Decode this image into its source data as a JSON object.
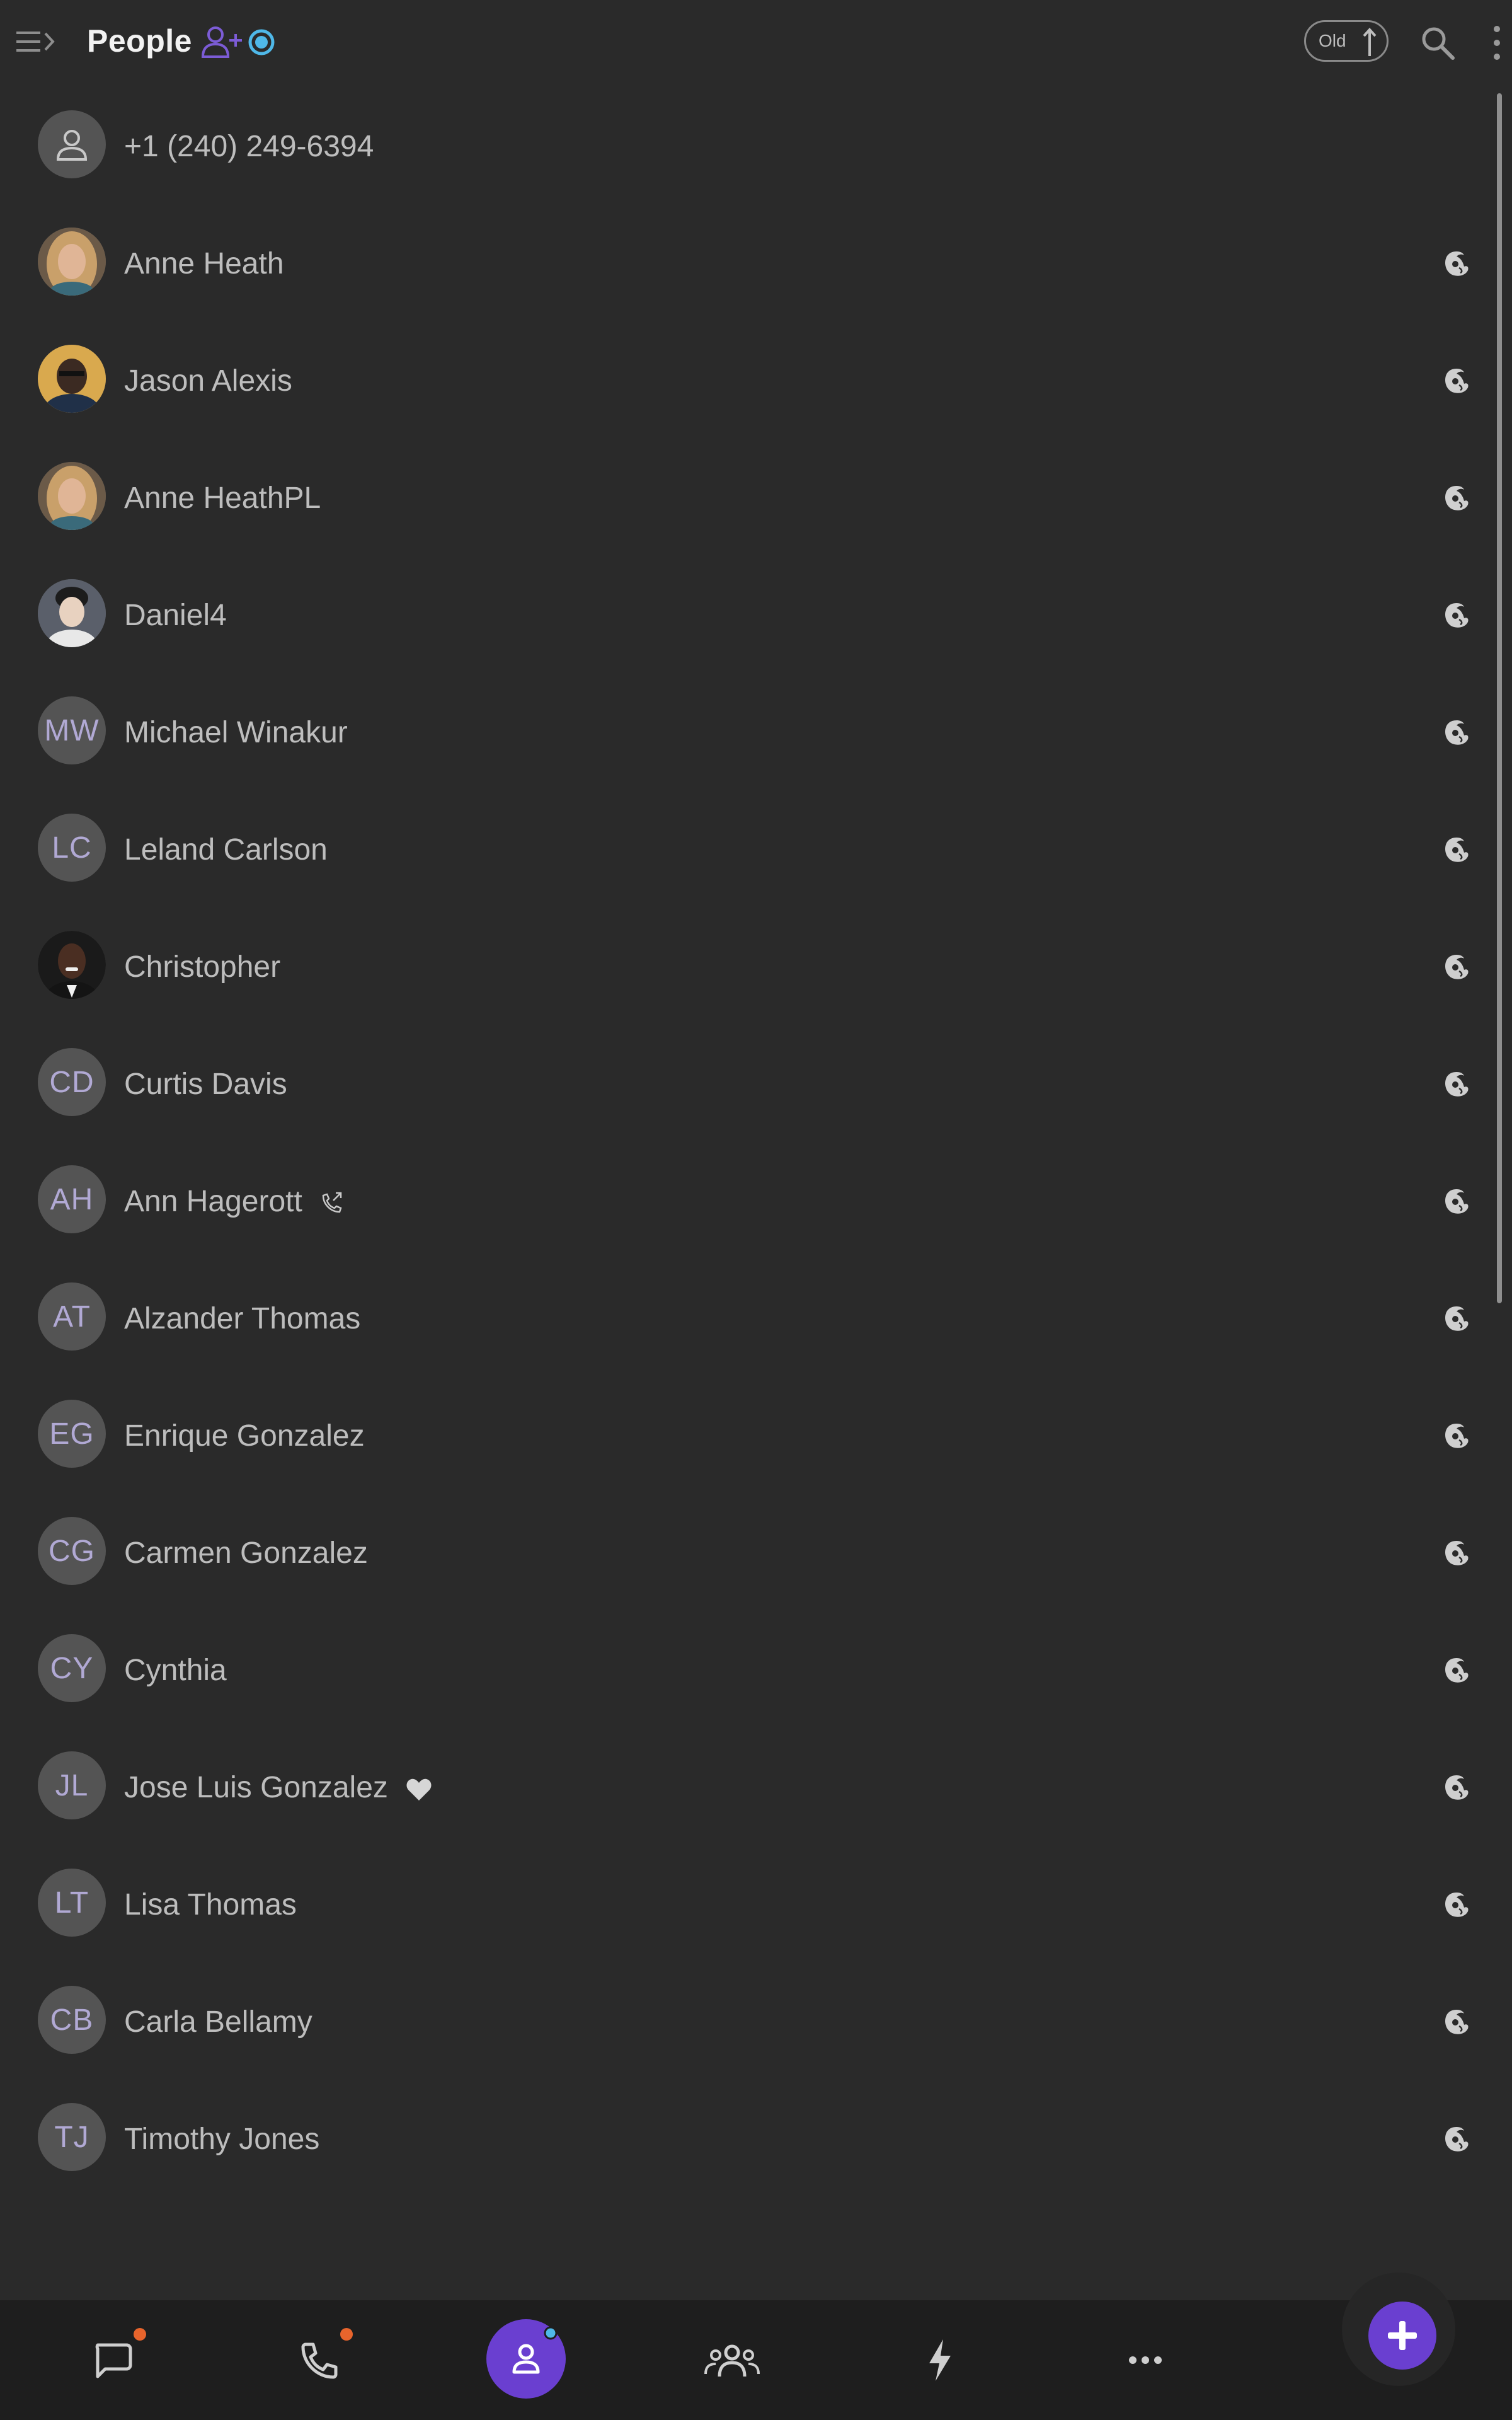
{
  "header": {
    "title": "People",
    "sort_label": "Old"
  },
  "colors": {
    "background": "#2a2a2a",
    "bottom_nav": "#1e1e1e",
    "accent": "#6a3fd0",
    "status_blue": "#4fb8e8",
    "badge_orange": "#e8642c",
    "avatar_gray": "#545454",
    "initials_lavender": "#b1a9d4"
  },
  "contacts": [
    {
      "name": "+1 (240) 249-6394",
      "avatar": "generic-person-icon"
    },
    {
      "name": "Anne Heath",
      "avatar": "photo"
    },
    {
      "name": "Jason Alexis",
      "avatar": "photo"
    },
    {
      "name": "Anne HeathPL",
      "avatar": "photo"
    },
    {
      "name": "Daniel4",
      "avatar": "photo"
    },
    {
      "name": "Michael Winakur",
      "initials": "MW"
    },
    {
      "name": "Leland Carlson",
      "initials": "LC"
    },
    {
      "name": "Christopher",
      "avatar": "photo"
    },
    {
      "name": "Curtis Davis",
      "initials": "CD"
    },
    {
      "name": "Ann Hagerott",
      "initials": "AH",
      "extra_icon": "call-forward-icon"
    },
    {
      "name": "Alzander Thomas",
      "initials": "AT"
    },
    {
      "name": "Enrique Gonzalez",
      "initials": "EG"
    },
    {
      "name": "Carmen Gonzalez",
      "initials": "CG"
    },
    {
      "name": "Cynthia",
      "initials": "CY"
    },
    {
      "name": "Jose Luis Gonzalez",
      "initials": "JL",
      "extra_icon": "heart-icon"
    },
    {
      "name": "Lisa Thomas",
      "initials": "LT"
    },
    {
      "name": "Carla Bellamy",
      "initials": "CB"
    },
    {
      "name": "Timothy Jones",
      "initials": "TJ"
    }
  ],
  "bottom_nav": {
    "items": [
      "chat-icon",
      "phone-icon",
      "person-icon",
      "group-icon",
      "lightning-icon",
      "more-horizontal-icon"
    ],
    "active": "person-icon"
  }
}
